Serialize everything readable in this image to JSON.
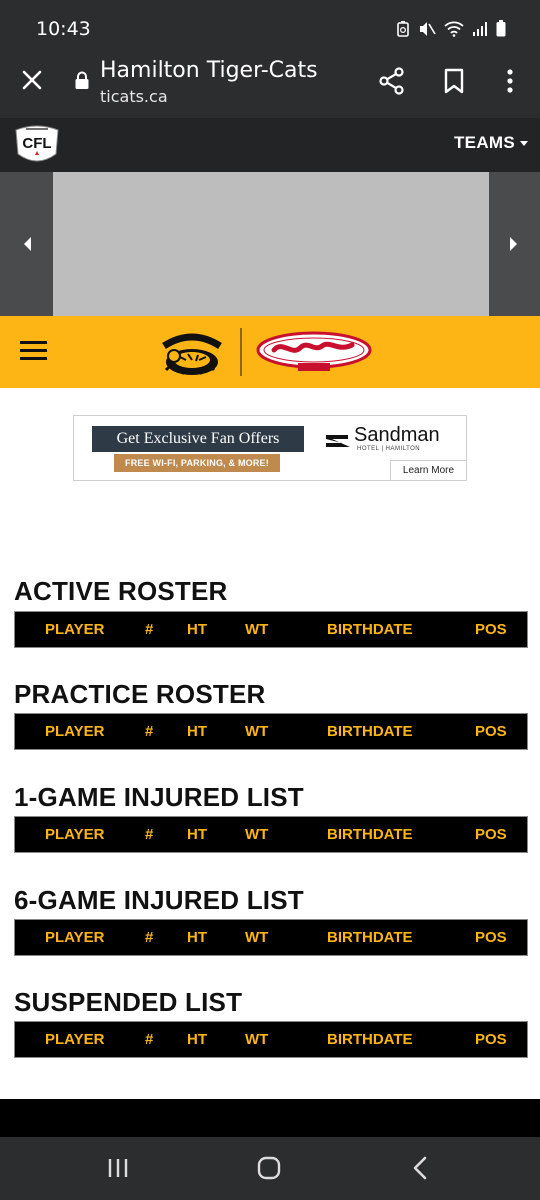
{
  "status_bar": {
    "time": "10:43"
  },
  "browser": {
    "title": "Hamilton Tiger-Cats",
    "url": "ticats.ca"
  },
  "league_bar": {
    "logo_text": "CFL",
    "teams_label": "TEAMS"
  },
  "ad": {
    "headline": "Get Exclusive Fan Offers",
    "perks": "FREE WI-FI, PARKING, & MORE!",
    "brand": "Sandman",
    "brand_sub": "HOTEL | HAMILTON",
    "cta": "Learn More"
  },
  "columns": [
    "PLAYER",
    "#",
    "HT",
    "WT",
    "BIRTHDATE",
    "POS"
  ],
  "sections": [
    {
      "title": "ACTIVE ROSTER"
    },
    {
      "title": "PRACTICE ROSTER"
    },
    {
      "title": "1-GAME INJURED LIST"
    },
    {
      "title": "6-GAME INJURED LIST"
    },
    {
      "title": "SUSPENDED LIST"
    }
  ],
  "colors": {
    "gold": "#fdb515",
    "dark": "#2b2d2f",
    "black": "#000000"
  }
}
